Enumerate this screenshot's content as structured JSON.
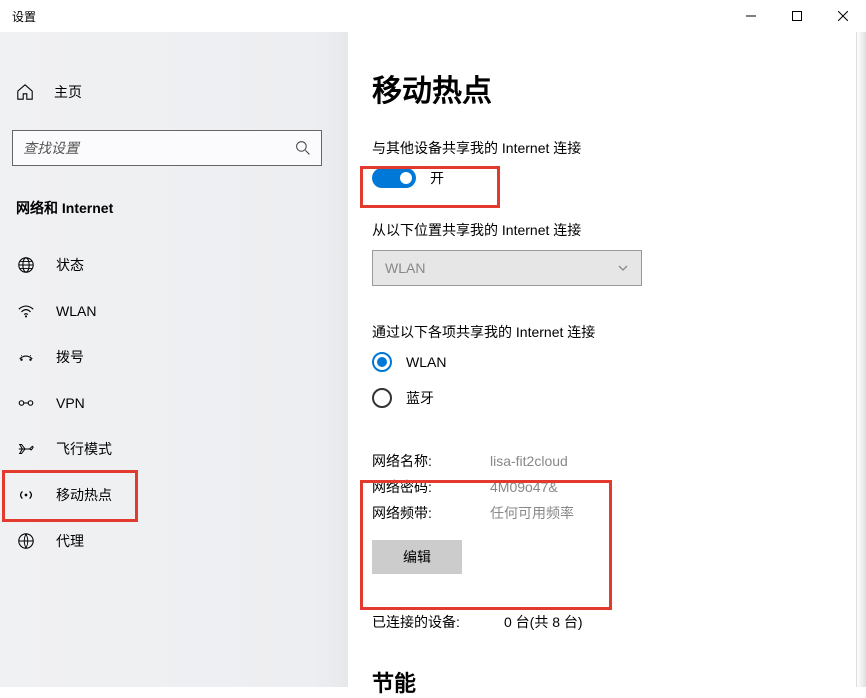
{
  "window": {
    "title": "设置"
  },
  "sidebar": {
    "home_label": "主页",
    "search_placeholder": "查找设置",
    "category": "网络和 Internet",
    "items": [
      {
        "label": "状态"
      },
      {
        "label": "WLAN"
      },
      {
        "label": "拨号"
      },
      {
        "label": "VPN"
      },
      {
        "label": "飞行模式"
      },
      {
        "label": "移动热点"
      },
      {
        "label": "代理"
      }
    ]
  },
  "main": {
    "title": "移动热点",
    "share_label": "与其他设备共享我的 Internet 连接",
    "toggle_state": "开",
    "share_from_label": "从以下位置共享我的 Internet 连接",
    "share_from_value": "WLAN",
    "share_via_label": "通过以下各项共享我的 Internet 连接",
    "radio_wlan": "WLAN",
    "radio_bt": "蓝牙",
    "info": {
      "name_label": "网络名称:",
      "name_value": "lisa-fit2cloud",
      "pwd_label": "网络密码:",
      "pwd_value": "4M09o47&",
      "band_label": "网络频带:",
      "band_value": "任何可用频率"
    },
    "edit_label": "编辑",
    "connected_label": "已连接的设备:",
    "connected_value": "0 台(共 8 台)",
    "power_heading": "节能"
  }
}
